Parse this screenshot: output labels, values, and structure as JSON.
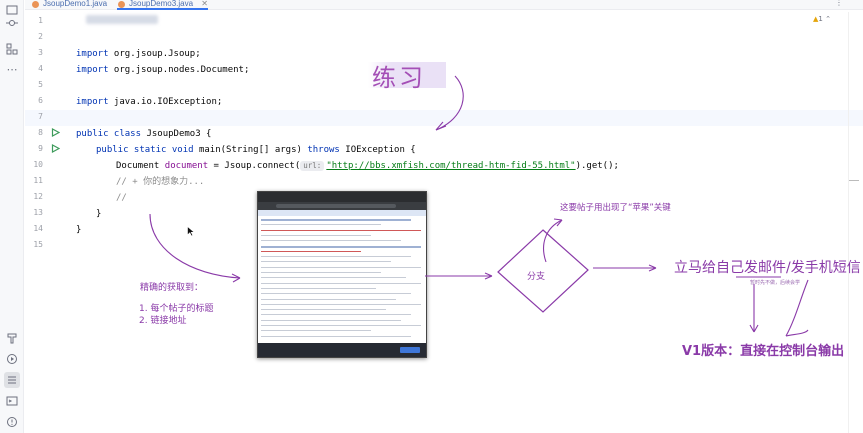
{
  "tabs": [
    {
      "label": "JsoupDemo1.java",
      "active": false
    },
    {
      "label": "JsoupDemo3.java",
      "active": true
    }
  ],
  "warnings_count": "1",
  "code_lines": [
    {
      "num": "1"
    },
    {
      "num": "2"
    },
    {
      "num": "3"
    },
    {
      "num": "4"
    },
    {
      "num": "5"
    },
    {
      "num": "6"
    },
    {
      "num": "7"
    },
    {
      "num": "8"
    },
    {
      "num": "9"
    },
    {
      "num": "10"
    },
    {
      "num": "11"
    },
    {
      "num": "12"
    },
    {
      "num": "13"
    },
    {
      "num": "14"
    },
    {
      "num": "15"
    }
  ],
  "code": {
    "l3_kw": "import",
    "l3_rest": " org.jsoup.Jsoup;",
    "l4_kw": "import",
    "l4_rest": " org.jsoup.nodes.Document;",
    "l6_kw": "import",
    "l6_rest": " java.io.IOException;",
    "l8_kw": "public class",
    "l8_rest": " JsoupDemo3 {",
    "l9_kw1": "public static void",
    "l9_mid": " main(String[] args) ",
    "l9_kw2": "throws",
    "l9_rest": " IOException {",
    "l10_type": "Document ",
    "l10_var": "document",
    "l10_mid": " = Jsoup.connect(",
    "l10_hint": "url:",
    "l10_str": "\"http://bbs.xmfish.com/thread-htm-fid-55.html\"",
    "l10_end": ").get();",
    "l11": "// + 你的想象力...",
    "l12": "//",
    "l13": "}",
    "l14": "}"
  },
  "annotations": {
    "practice": "练习",
    "accurate": "精确的获取到：",
    "item1": "1. 每个帖子的标题",
    "item2": "2. 链接地址",
    "branch": "分支",
    "apple_note": "这要帖子用出现了“苹果”关键",
    "notify": "立马给自己发邮件/发手机短信",
    "small_note": "暂时先不做，后续会学",
    "v1": "V1版本：直接在控制台输出"
  },
  "colors": {
    "annotation": "#8a3aa8",
    "keyword": "#0033b3",
    "string": "#067d17",
    "comment": "#8c8c8c"
  }
}
